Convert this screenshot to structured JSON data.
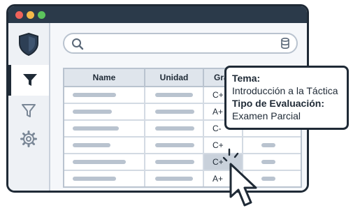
{
  "window": {
    "controls": [
      "close",
      "minimize",
      "maximize"
    ],
    "colors": {
      "close": "#f0625a",
      "minimize": "#f5b84a",
      "maximize": "#5cc45c"
    }
  },
  "sidebar": {
    "items": [
      {
        "icon": "shield-icon",
        "active": false
      },
      {
        "icon": "filter-icon",
        "active": true
      },
      {
        "icon": "filter-outline-icon",
        "active": false
      },
      {
        "icon": "gear-icon",
        "active": false
      }
    ]
  },
  "search": {
    "value": "",
    "placeholder": "",
    "left_icon": "search-icon",
    "right_icon": "database-icon"
  },
  "table": {
    "headers": [
      "Name",
      "Unidad",
      "Grad",
      ""
    ],
    "rows": [
      {
        "grade": "C+",
        "selected": false
      },
      {
        "grade": "A+",
        "selected": false
      },
      {
        "grade": "C-",
        "selected": false
      },
      {
        "grade": "C+",
        "selected": false
      },
      {
        "grade": "C+",
        "selected": true
      },
      {
        "grade": "A+",
        "selected": false
      }
    ]
  },
  "tooltip": {
    "tema_label": "Tema:",
    "tema_value": "Introducción a la Táctica",
    "tipo_label": "Tipo de Evaluación:",
    "tipo_value": "Examen Parcial"
  },
  "cursor": {
    "icon": "pointer-cursor-icon"
  }
}
